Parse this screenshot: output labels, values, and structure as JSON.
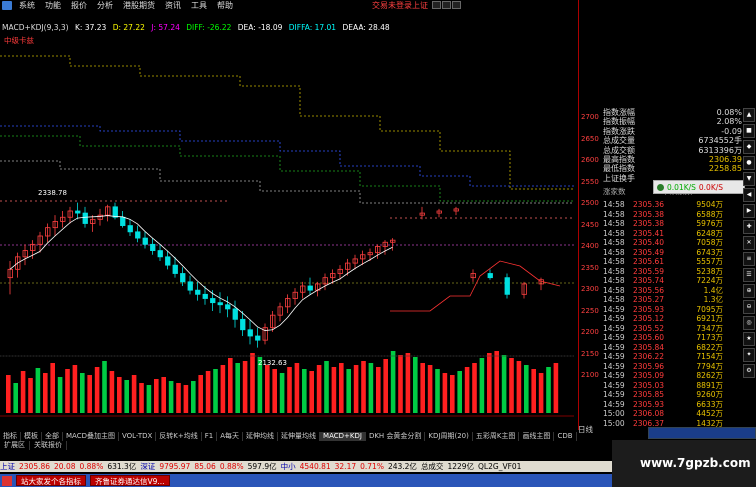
{
  "menu": {
    "items": [
      "系统",
      "功能",
      "报价",
      "分析",
      "港股期货",
      "资讯",
      "工具",
      "帮助"
    ],
    "login_status": "交易未登录",
    "login_link": "上证"
  },
  "indicator": {
    "name": "MACD+KDJ(9,3,3)",
    "values": [
      {
        "label": "K: 37.23",
        "color": "#ffffff"
      },
      {
        "label": "D: 27.22",
        "color": "#ffff00"
      },
      {
        "label": "J: 57.24",
        "color": "#ff00ff"
      },
      {
        "label": "DIFF: -26.22",
        "color": "#00ff00"
      },
      {
        "label": "DEA: -18.09",
        "color": "#ffffff"
      },
      {
        "label": "DIFFA: 17.01",
        "color": "#00ffff"
      },
      {
        "label": "DEAA: 28.48",
        "color": "#ffffff"
      }
    ],
    "sub_label": "中级卡兹",
    "high_marker": "2338.78",
    "low_marker": "2132.63"
  },
  "yaxis": [
    "2700",
    "2650",
    "2600",
    "2550",
    "2500",
    "2450",
    "2400",
    "2350",
    "2300",
    "2250",
    "2200",
    "2150",
    "2100"
  ],
  "stats": [
    {
      "label": "指数涨幅",
      "value": "0.08%"
    },
    {
      "label": "指数振幅",
      "value": "2.08%"
    },
    {
      "label": "指数涨跌",
      "value": "-0.09"
    },
    {
      "label": "总成交量",
      "value": "6734552手"
    },
    {
      "label": "总成交额",
      "value": "6313396万"
    },
    {
      "label": "最高指数",
      "value": "2306.39"
    },
    {
      "label": "最低指数",
      "value": "2258.85"
    },
    {
      "label": "上证换手",
      "value": ""
    }
  ],
  "tick_header": {
    "left": "涨家数",
    "mid": "下跌家数",
    "right": "147"
  },
  "ticks": [
    {
      "time": "14:58",
      "price": "2305.36",
      "vol": "9504万"
    },
    {
      "time": "14:58",
      "price": "2305.38",
      "vol": "6588万"
    },
    {
      "time": "14:58",
      "price": "2305.38",
      "vol": "5976万"
    },
    {
      "time": "14:58",
      "price": "2305.41",
      "vol": "6248万"
    },
    {
      "time": "14:58",
      "price": "2305.40",
      "vol": "7058万"
    },
    {
      "time": "14:58",
      "price": "2305.49",
      "vol": "6743万"
    },
    {
      "time": "14:58",
      "price": "2305.61",
      "vol": "5557万"
    },
    {
      "time": "14:58",
      "price": "2305.59",
      "vol": "5238万"
    },
    {
      "time": "14:58",
      "price": "2305.74",
      "vol": "7224万"
    },
    {
      "time": "14:58",
      "price": "2305.56",
      "vol": "1.4亿"
    },
    {
      "time": "14:58",
      "price": "2305.27",
      "vol": "1.3亿"
    },
    {
      "time": "14:59",
      "price": "2305.93",
      "vol": "7095万"
    },
    {
      "time": "14:59",
      "price": "2305.12",
      "vol": "6921万"
    },
    {
      "time": "14:59",
      "price": "2305.52",
      "vol": "7347万"
    },
    {
      "time": "14:59",
      "price": "2305.60",
      "vol": "7173万"
    },
    {
      "time": "14:59",
      "price": "2305.84",
      "vol": "6822万"
    },
    {
      "time": "14:59",
      "price": "2306.22",
      "vol": "7154万"
    },
    {
      "time": "14:59",
      "price": "2305.96",
      "vol": "7794万"
    },
    {
      "time": "14:59",
      "price": "2305.09",
      "vol": "8262万"
    },
    {
      "time": "14:59",
      "price": "2305.03",
      "vol": "8891万"
    },
    {
      "time": "14:59",
      "price": "2305.85",
      "vol": "9260万"
    },
    {
      "time": "14:59",
      "price": "2305.93",
      "vol": "6633万"
    },
    {
      "time": "15:00",
      "price": "2306.08",
      "vol": "4452万"
    },
    {
      "time": "15:00",
      "price": "2306.37",
      "vol": "1432万"
    }
  ],
  "float_widget": {
    "up": "0.01K/S",
    "down": "0.0K/S"
  },
  "timeframe": "日线",
  "bottom_tabs": [
    "指标",
    "模板",
    "全部",
    "MACD叠加主图",
    "VOL-TDX",
    "反转K+均线",
    "F1",
    "A每天",
    "延伸均线",
    "延伸量均线",
    "MACD+KDJ",
    "DKH 会黄金分割",
    "KDJ周期(20)",
    "五彩周K主图",
    "画线主图",
    "CDB"
  ],
  "bottom_tabs2": [
    "扩展区",
    "关联报价"
  ],
  "status_bar": {
    "sh_label": "上证",
    "sh_value": "2305.86",
    "sh_change": "20.08",
    "sh_pct": "0.88%",
    "sh_amount": "631.3亿",
    "sz_label": "深证",
    "sz_value": "9795.97",
    "sz_change": "85.06",
    "sz_pct": "0.88%",
    "sz_amount": "597.9亿",
    "mid_label": "中小",
    "mid_value": "4540.81",
    "mid_change": "32.17",
    "mid_pct": "0.71%",
    "mid_amount": "243.2亿",
    "total_label": "总成交",
    "total_value": "1229亿",
    "code": "QL2G_VF01"
  },
  "taskbar": {
    "items": [
      "站大家发个各指标",
      "齐鲁证券通达信V9..."
    ]
  },
  "watermark": "www.7gpzb.com",
  "chart_data": {
    "type": "candlestick",
    "ylim": [
      2100,
      2700
    ],
    "candles": [
      [
        2300,
        2340,
        2260,
        2320
      ],
      [
        2320,
        2360,
        2300,
        2350
      ],
      [
        2350,
        2380,
        2330,
        2365
      ],
      [
        2365,
        2390,
        2345,
        2380
      ],
      [
        2380,
        2410,
        2360,
        2400
      ],
      [
        2400,
        2430,
        2385,
        2420
      ],
      [
        2420,
        2450,
        2400,
        2435
      ],
      [
        2435,
        2460,
        2420,
        2445
      ],
      [
        2445,
        2470,
        2430,
        2460
      ],
      [
        2460,
        2480,
        2440,
        2455
      ],
      [
        2455,
        2470,
        2420,
        2430
      ],
      [
        2430,
        2450,
        2410,
        2440
      ],
      [
        2440,
        2465,
        2425,
        2450
      ],
      [
        2450,
        2475,
        2435,
        2470
      ],
      [
        2470,
        2480,
        2440,
        2445
      ],
      [
        2445,
        2460,
        2420,
        2425
      ],
      [
        2425,
        2440,
        2400,
        2410
      ],
      [
        2410,
        2425,
        2385,
        2395
      ],
      [
        2395,
        2410,
        2370,
        2380
      ],
      [
        2380,
        2395,
        2355,
        2365
      ],
      [
        2365,
        2380,
        2340,
        2350
      ],
      [
        2350,
        2365,
        2320,
        2330
      ],
      [
        2330,
        2350,
        2300,
        2310
      ],
      [
        2310,
        2325,
        2280,
        2290
      ],
      [
        2290,
        2305,
        2260,
        2270
      ],
      [
        2270,
        2290,
        2245,
        2260
      ],
      [
        2260,
        2280,
        2235,
        2250
      ],
      [
        2250,
        2270,
        2220,
        2240
      ],
      [
        2240,
        2265,
        2215,
        2235
      ],
      [
        2235,
        2255,
        2205,
        2225
      ],
      [
        2225,
        2245,
        2180,
        2200
      ],
      [
        2200,
        2220,
        2160,
        2175
      ],
      [
        2175,
        2200,
        2140,
        2160
      ],
      [
        2160,
        2180,
        2132,
        2150
      ],
      [
        2150,
        2190,
        2140,
        2180
      ],
      [
        2180,
        2220,
        2170,
        2210
      ],
      [
        2210,
        2240,
        2195,
        2230
      ],
      [
        2230,
        2260,
        2215,
        2250
      ],
      [
        2250,
        2275,
        2235,
        2265
      ],
      [
        2265,
        2290,
        2250,
        2280
      ],
      [
        2280,
        2300,
        2260,
        2270
      ],
      [
        2270,
        2290,
        2255,
        2285
      ],
      [
        2285,
        2310,
        2270,
        2300
      ],
      [
        2300,
        2320,
        2285,
        2310
      ],
      [
        2310,
        2330,
        2295,
        2320
      ],
      [
        2320,
        2345,
        2305,
        2335
      ],
      [
        2335,
        2355,
        2320,
        2345
      ],
      [
        2345,
        2365,
        2330,
        2355
      ],
      [
        2355,
        2370,
        2340,
        2360
      ],
      [
        2360,
        2380,
        2345,
        2375
      ],
      [
        2375,
        2390,
        2355,
        2385
      ],
      [
        2385,
        2395,
        2365,
        2390
      ]
    ],
    "volumes": [
      38,
      30,
      42,
      35,
      45,
      40,
      50,
      36,
      44,
      48,
      40,
      38,
      46,
      52,
      42,
      36,
      33,
      38,
      30,
      28,
      34,
      36,
      32,
      30,
      28,
      32,
      38,
      42,
      44,
      48,
      55,
      50,
      52,
      60,
      56,
      48,
      44,
      40,
      46,
      50,
      44,
      42,
      48,
      52,
      46,
      50,
      44,
      48,
      52,
      50,
      46,
      54,
      62,
      58,
      60,
      56,
      50,
      48,
      44,
      40,
      38,
      42,
      46,
      50,
      55,
      60,
      62,
      58,
      55,
      52,
      48,
      44,
      40,
      46,
      50
    ]
  }
}
